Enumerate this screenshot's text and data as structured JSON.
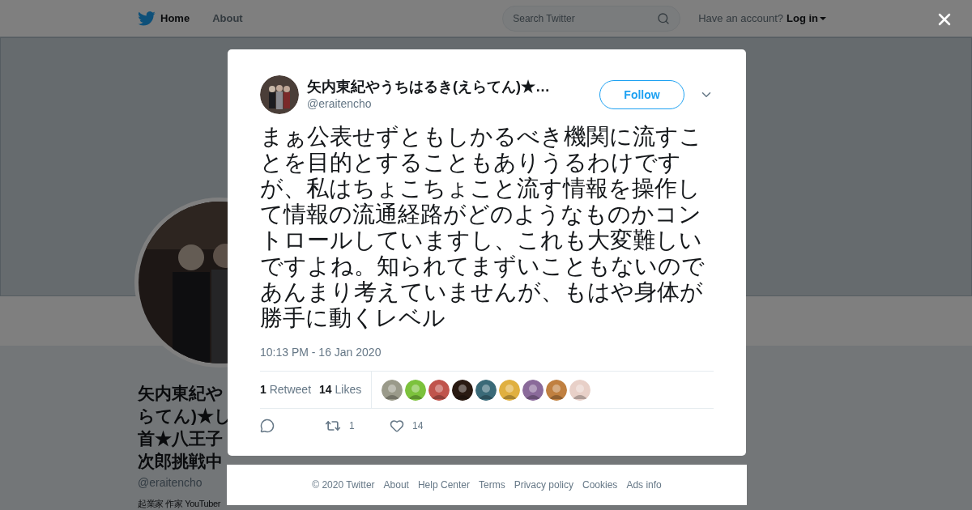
{
  "nav": {
    "items": [
      {
        "label": "Home",
        "selected": true
      },
      {
        "label": "About",
        "selected": false
      }
    ],
    "search": {
      "placeholder": "Search Twitter"
    },
    "account_prompt": "Have an account?",
    "login": "Log in"
  },
  "profile": {
    "name_lines": [
      "矢内東紀や",
      "らてん)★し",
      "首★八王子",
      "次郎挑戦中"
    ],
    "handle": "@eraitencho",
    "bio": "起業家 作家 YouTuber"
  },
  "tweet": {
    "author": "矢内東紀やうちはるき(えらてん)★…",
    "handle": "@eraitencho",
    "follow": "Follow",
    "text": "まぁ公表せずともしかるべき機関に流すことを目的とすることもありうるわけですが、私はちょこちょこと流す情報を操作して情報の流通経路がどのようなものかコントロールしていますし、これも大変難しいですよね。知られてまずいこともないのであんまり考えていませんが、もはや身体が勝手に動くレベル",
    "timestamp": "10:13 PM - 16 Jan 2020",
    "stats": [
      {
        "count": "1",
        "label": "Retweet"
      },
      {
        "count": "14",
        "label": "Likes"
      }
    ],
    "actions": [
      {
        "kind": "reply"
      },
      {
        "kind": "retweet",
        "count": "1"
      },
      {
        "kind": "like",
        "count": "14"
      }
    ]
  },
  "footer": [
    "© 2020 Twitter",
    "About",
    "Help Center",
    "Terms",
    "Privacy policy",
    "Cookies",
    "Ads info"
  ]
}
